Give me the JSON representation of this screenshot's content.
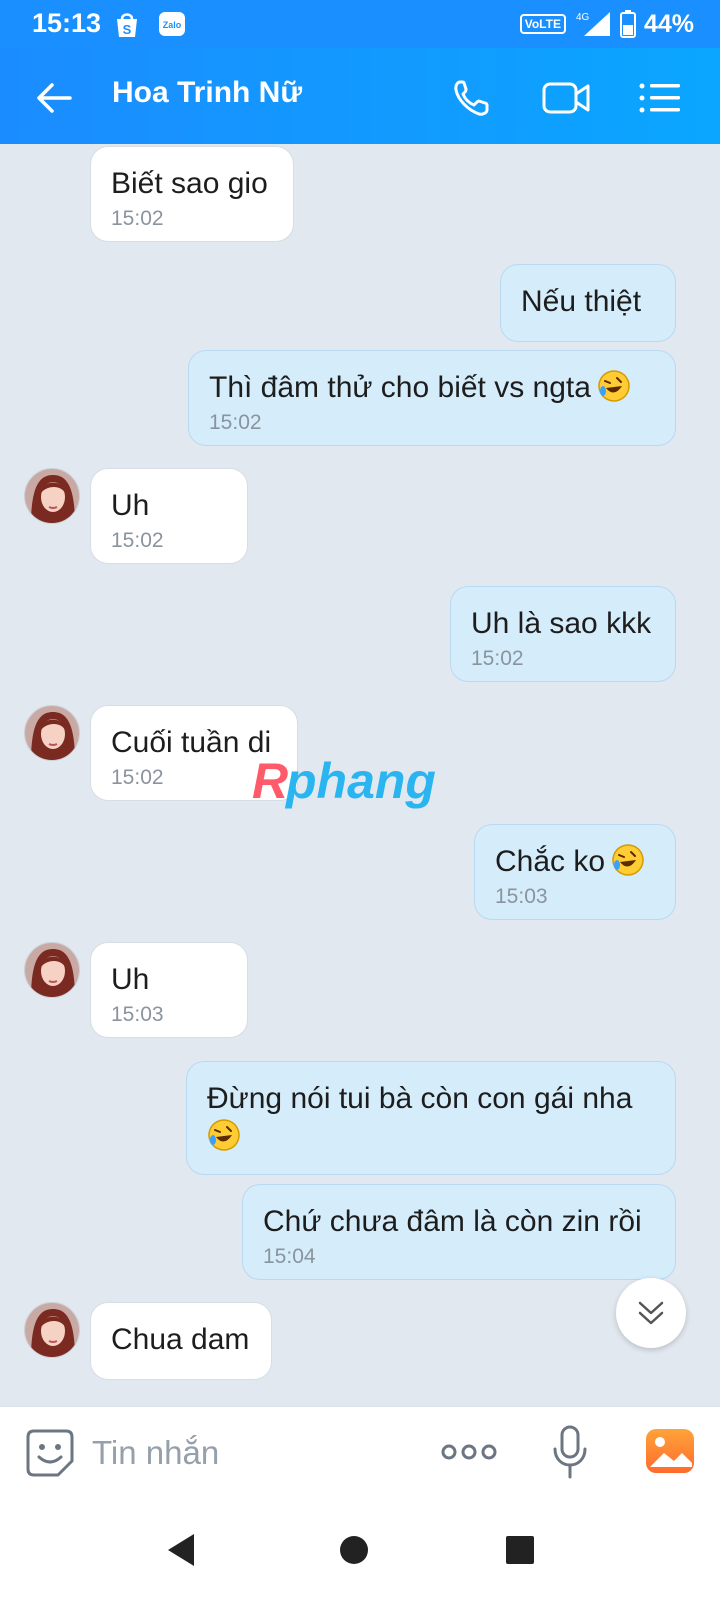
{
  "status_bar": {
    "time": "15:13",
    "network": "VoLTE",
    "network_type": "4G",
    "battery": "44%",
    "icons": [
      "shopee-icon",
      "zalo-icon",
      "signal-icon",
      "battery-icon"
    ]
  },
  "header": {
    "contact_name": "Hoa Trinh Nữ",
    "icons": [
      "back-arrow-icon",
      "phone-icon",
      "video-call-icon",
      "menu-list-icon"
    ]
  },
  "messages": [
    {
      "direction": "in",
      "text": "Biết sao gio",
      "time": "15:02"
    },
    {
      "direction": "out",
      "text": "Nếu thiệt",
      "time": ""
    },
    {
      "direction": "out",
      "text": "Thì đâm thử cho biết vs ngta",
      "emoji": "rofl",
      "time": "15:02"
    },
    {
      "direction": "in",
      "text": "Uh",
      "time": "15:02"
    },
    {
      "direction": "out",
      "text": "Uh là sao kkk",
      "time": "15:02"
    },
    {
      "direction": "in",
      "text": "Cuối tuần di",
      "time": "15:02"
    },
    {
      "direction": "out",
      "text": "Chắc ko",
      "emoji": "rofl",
      "time": "15:03"
    },
    {
      "direction": "in",
      "text": "Uh",
      "time": "15:03"
    },
    {
      "direction": "out",
      "text": "Đừng nói tui bà còn con gái nha",
      "emoji": "rofl",
      "time": ""
    },
    {
      "direction": "out",
      "text": "Chứ chưa đâm là còn zin rồi",
      "time": "15:04"
    },
    {
      "direction": "in",
      "text": "Chua dam",
      "time": ""
    }
  ],
  "watermark": "Rphang",
  "input_bar": {
    "placeholder": "Tin nhắn",
    "icons": [
      "sticker-icon",
      "more-options-icon",
      "microphone-icon",
      "image-icon"
    ]
  },
  "colors": {
    "header_blue": "#1b8cff",
    "outgoing_bubble": "#d5ecfb",
    "incoming_bubble": "#ffffff",
    "chat_background": "#e2e8f0"
  }
}
